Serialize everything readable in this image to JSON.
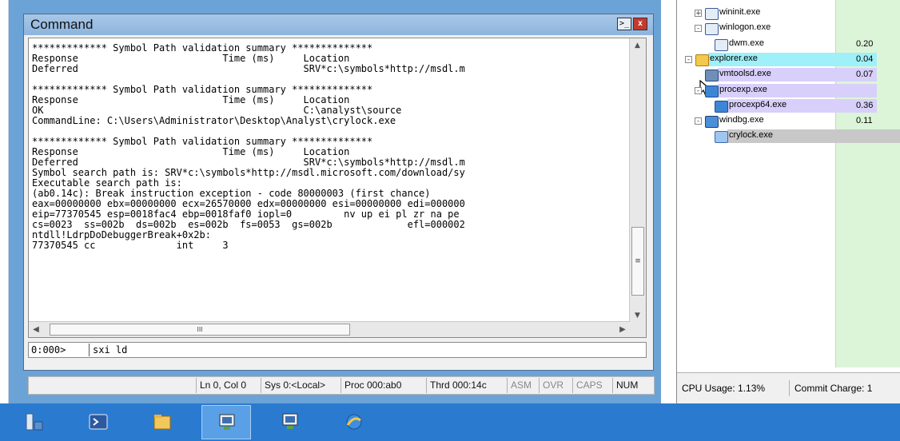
{
  "command_window": {
    "title": "Command",
    "controls": {
      "cmd_icon": "cmd-icon",
      "close": "x"
    },
    "output_lines": [
      "************* Symbol Path validation summary **************",
      "Response                         Time (ms)     Location",
      "Deferred                                       SRV*c:\\symbols*http://msdl.m",
      "",
      "************* Symbol Path validation summary **************",
      "Response                         Time (ms)     Location",
      "OK                                             C:\\analyst\\source",
      "CommandLine: C:\\Users\\Administrator\\Desktop\\Analyst\\crylock.exe",
      "",
      "************* Symbol Path validation summary **************",
      "Response                         Time (ms)     Location",
      "Deferred                                       SRV*c:\\symbols*http://msdl.m",
      "Symbol search path is: SRV*c:\\symbols*http://msdl.microsoft.com/download/sy",
      "Executable search path is:",
      "(ab0.14c): Break instruction exception - code 80000003 (first chance)",
      "eax=00000000 ebx=00000000 ecx=26570000 edx=00000000 esi=00000000 edi=000000",
      "eip=77370545 esp=0018fac4 ebp=0018faf0 iopl=0         nv up ei pl zr na pe",
      "cs=0023  ss=002b  ds=002b  es=002b  fs=0053  gs=002b             efl=000002",
      "ntdll!LdrpDoDebuggerBreak+0x2b:",
      "77370545 cc              int     3"
    ],
    "prompt": "0:000>",
    "input_value": "sxi ld"
  },
  "status_bar": {
    "position": "Ln 0, Col 0",
    "sys": "Sys 0:<Local>",
    "proc": "Proc 000:ab0",
    "thrd": "Thrd 000:14c",
    "asm": "ASM",
    "ovr": "OVR",
    "caps": "CAPS",
    "num": "NUM"
  },
  "process_explorer": {
    "processes": [
      {
        "name": "wininit.exe",
        "cpu": "",
        "indent": 1,
        "expander": "+",
        "icon": "exe-icon",
        "highlight": ""
      },
      {
        "name": "winlogon.exe",
        "cpu": "",
        "indent": 1,
        "expander": "-",
        "icon": "exe-icon",
        "highlight": ""
      },
      {
        "name": "dwm.exe",
        "cpu": "0.20",
        "indent": 2,
        "expander": "",
        "icon": "exe-icon",
        "highlight": ""
      },
      {
        "name": "explorer.exe",
        "cpu": "0.04",
        "indent": 0,
        "expander": "-",
        "icon": "folder-icon",
        "highlight": "#9ff0f8"
      },
      {
        "name": "vmtoolsd.exe",
        "cpu": "0.07",
        "indent": 1,
        "expander": "",
        "icon": "vm-icon",
        "highlight": "#d8d0fa"
      },
      {
        "name": "procexp.exe",
        "cpu": "",
        "indent": 1,
        "expander": "-",
        "icon": "procexp-icon",
        "highlight": "#d8d0fa"
      },
      {
        "name": "procexp64.exe",
        "cpu": "0.36",
        "indent": 2,
        "expander": "",
        "icon": "procexp-icon",
        "highlight": "#d8d0fa"
      },
      {
        "name": "windbg.exe",
        "cpu": "0.11",
        "indent": 1,
        "expander": "-",
        "icon": "windbg-icon",
        "highlight": ""
      },
      {
        "name": "crylock.exe",
        "cpu": "",
        "indent": 2,
        "expander": "",
        "icon": "app-icon",
        "highlight": "#c8c8c8"
      }
    ],
    "cpu_usage": "CPU Usage: 1.13%",
    "commit_charge": "Commit Charge: 1"
  },
  "taskbar": {
    "items": [
      {
        "icon": "server-manager-icon",
        "active": false
      },
      {
        "icon": "powershell-icon",
        "active": false
      },
      {
        "icon": "file-explorer-icon",
        "active": false
      },
      {
        "icon": "windbg-icon",
        "active": true
      },
      {
        "icon": "windbg-icon",
        "active": false
      },
      {
        "icon": "procexp-icon",
        "active": false
      }
    ]
  },
  "colors": {
    "desktop": "#6ba3d6",
    "taskbar": "#2a7bd0",
    "explorer_highlight": "#9ff0f8",
    "own_process_highlight": "#d8d0fa",
    "cpu_column": "#dcf5d8"
  }
}
